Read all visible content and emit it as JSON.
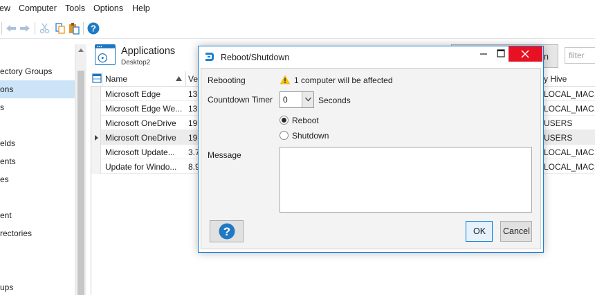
{
  "menubar": {
    "items": [
      "ew",
      "Computer",
      "Tools",
      "Options",
      "Help"
    ]
  },
  "toolbar": {
    "icons": [
      "back-arrow-icon",
      "forward-arrow-icon",
      "cut-icon",
      "copy-icon",
      "paste-icon",
      "help-icon"
    ]
  },
  "tree": {
    "items": [
      {
        "label": ""
      },
      {
        "label": "ectory Groups"
      },
      {
        "label": "ons",
        "selected": true
      },
      {
        "label": "s"
      },
      {
        "label": ""
      },
      {
        "label": "elds"
      },
      {
        "label": "ents"
      },
      {
        "label": "es"
      },
      {
        "label": ""
      },
      {
        "label": "ent"
      },
      {
        "label": "rectories"
      },
      {
        "label": ""
      },
      {
        "label": "ups"
      }
    ]
  },
  "app": {
    "title": "Applications",
    "subtitle": "Desktop2",
    "filter_placeholder": "filter",
    "partial_button_text": "n"
  },
  "grid": {
    "columns": [
      "Name",
      "Ve",
      "y Hive"
    ],
    "rows": [
      {
        "name": "Microsoft Edge",
        "version": "13",
        "hive": "LOCAL_MAC..."
      },
      {
        "name": "Microsoft Edge We...",
        "version": "13",
        "hive": "LOCAL_MAC..."
      },
      {
        "name": "Microsoft OneDrive",
        "version": "19",
        "hive": "USERS"
      },
      {
        "name": "Microsoft OneDrive",
        "version": "19",
        "hive": "USERS",
        "current": true
      },
      {
        "name": "Microsoft Update...",
        "version": "3.7",
        "hive": "LOCAL_MAC..."
      },
      {
        "name": "Update for Windo...",
        "version": "8.9",
        "hive": "LOCAL_MAC..."
      }
    ]
  },
  "dialog": {
    "title": "Reboot/Shutdown",
    "rebooting_label": "Rebooting",
    "warning_text": "1 computer will be affected",
    "countdown_label": "Countdown Timer",
    "countdown_value": "0",
    "countdown_unit": "Seconds",
    "option_reboot": "Reboot",
    "option_shutdown": "Shutdown",
    "selected_option": "Reboot",
    "message_label": "Message",
    "message_value": "",
    "ok_label": "OK",
    "cancel_label": "Cancel"
  },
  "colors": {
    "accent": "#1c7fd6",
    "close_red": "#e81123",
    "selection": "#cce4f7",
    "warning": "#f4c20d",
    "help_blue": "#1f7ac3"
  }
}
